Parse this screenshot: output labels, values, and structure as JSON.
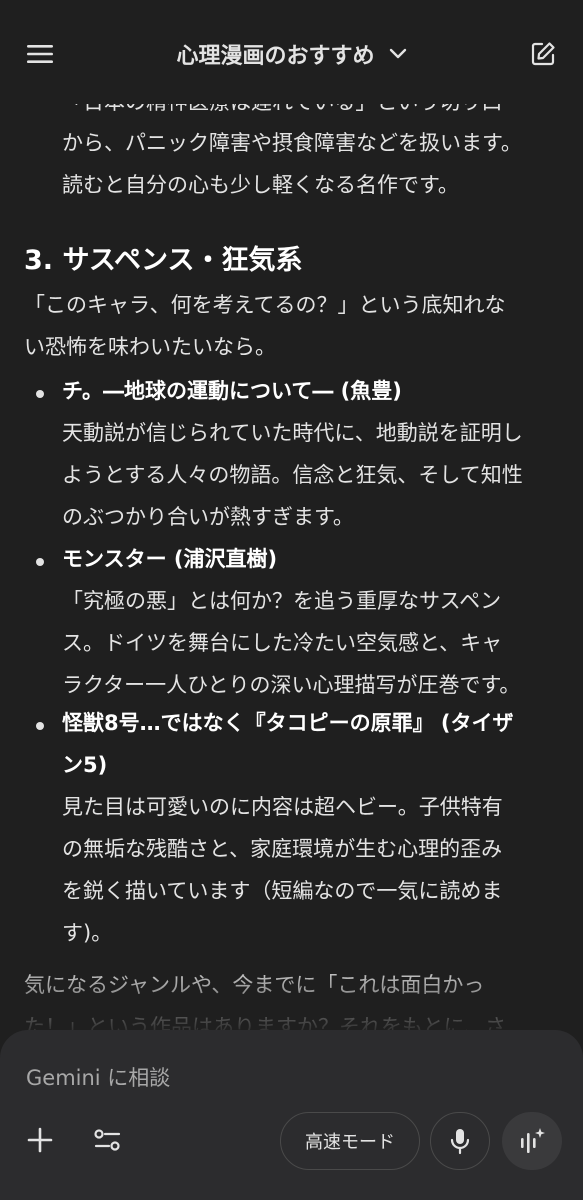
{
  "header": {
    "title": "心理漫画のおすすめ"
  },
  "content": {
    "cut_line": "「日本の精神医療は遅れている」という切り口",
    "prev_lines": [
      "から、パニック障害や摂食障害などを扱います。",
      "読むと自分の心も少し軽くなる名作です。"
    ],
    "section3": {
      "heading": "3. サスペンス・狂気系",
      "intro": [
        "「このキャラ、何を考えてるの？」という底知れな",
        "い恐怖を味わいたいなら。"
      ],
      "items": [
        {
          "title": "チ。―地球の運動について― (魚豊)",
          "desc": [
            "天動説が信じられていた時代に、地動説を証明し",
            "ようとする人々の物語。信念と狂気、そして知性",
            "のぶつかり合いが熱すぎます。"
          ]
        },
        {
          "title": "モンスター (浦沢直樹)",
          "desc": [
            "「究極の悪」とは何か？を追う重厚なサスペン",
            "ス。ドイツを舞台にした冷たい空気感と、キャ",
            "ラクター一人ひとりの深い心理描写が圧巻です。"
          ]
        },
        {
          "title_lines": [
            "怪獣8号…ではなく『タコピーの原罪』 (タイザ",
            "ン5)"
          ],
          "desc": [
            "見た目は可愛いのに内容は超ヘビー。子供特有",
            "の無垢な残酷さと、家庭環境が生む心理的歪み",
            "を鋭く描いています（短編なので一気に読めま",
            "す)。"
          ]
        }
      ]
    },
    "closing": [
      "気になるジャンルや、今までに「これは面白かっ",
      "た！」という作品はありますか？それをもとに、さ"
    ]
  },
  "composer": {
    "placeholder": "Gemini に相談",
    "mode_label": "高速モード"
  }
}
